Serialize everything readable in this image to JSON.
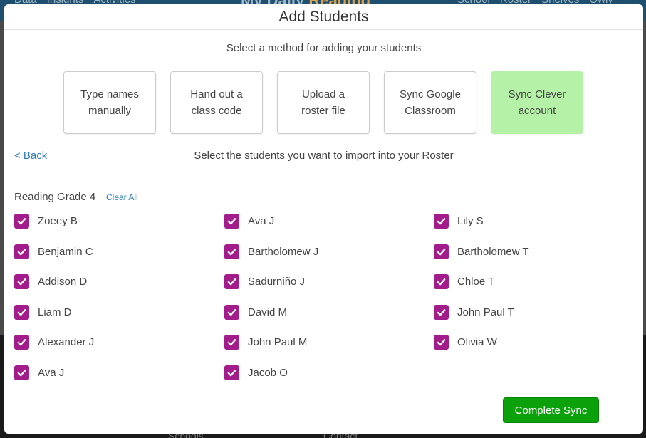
{
  "background": {
    "nav_left": [
      "Data",
      "Insights",
      "Activities"
    ],
    "logo_left": "My Daily",
    "logo_right": "Reading",
    "nav_right": [
      "School",
      "Roster",
      "Shelves",
      "Owly"
    ],
    "footer_left": "Schools",
    "footer_right": "Contact"
  },
  "modal": {
    "title": "Add Students",
    "instruction": "Select a method for adding your students",
    "methods": [
      {
        "label": "Type names manually",
        "active": false
      },
      {
        "label": "Hand out a class code",
        "active": false
      },
      {
        "label": "Upload a roster file",
        "active": false
      },
      {
        "label": "Sync Google Classroom",
        "active": false
      },
      {
        "label": "Sync Clever account",
        "active": true
      }
    ],
    "back_label": "< Back",
    "select_prompt": "Select the students you want to import into your Roster",
    "roster_name": "Reading Grade 4",
    "clear_all_label": "Clear All",
    "students": [
      {
        "name": "Zoeey B",
        "checked": true
      },
      {
        "name": "Benjamin C",
        "checked": true
      },
      {
        "name": "Addison D",
        "checked": true
      },
      {
        "name": "Liam D",
        "checked": true
      },
      {
        "name": "Alexander J",
        "checked": true
      },
      {
        "name": "Ava J",
        "checked": true
      },
      {
        "name": "Ava J",
        "checked": true
      },
      {
        "name": "Bartholomew J",
        "checked": true
      },
      {
        "name": "Sadurniño J",
        "checked": true
      },
      {
        "name": "David M",
        "checked": true
      },
      {
        "name": "John Paul M",
        "checked": true
      },
      {
        "name": "Jacob O",
        "checked": true
      },
      {
        "name": "Lily S",
        "checked": true
      },
      {
        "name": "Bartholomew T",
        "checked": true
      },
      {
        "name": "Chloe T",
        "checked": true
      },
      {
        "name": "John Paul T",
        "checked": true
      },
      {
        "name": "Olivia W",
        "checked": true
      }
    ],
    "complete_label": "Complete Sync"
  },
  "colors": {
    "checkbox": "#a21c8c",
    "active_method": "#b5f2a8",
    "complete_button": "#0aa10a",
    "link": "#2a7ab8"
  }
}
